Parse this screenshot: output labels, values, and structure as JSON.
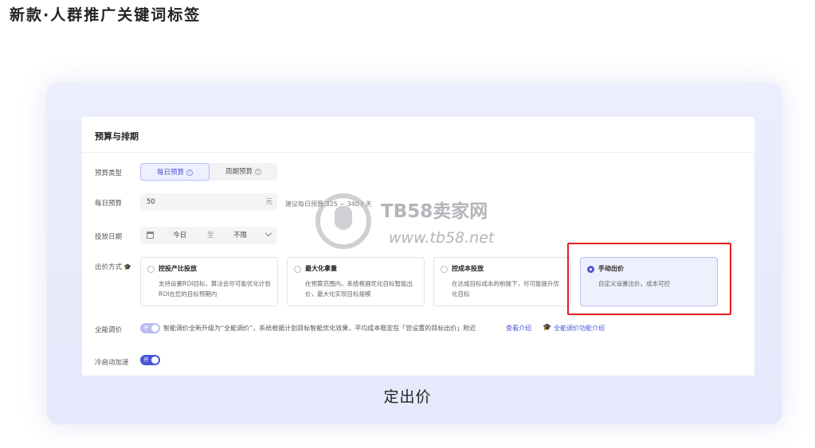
{
  "page": {
    "title": "新款·人群推广关键词标签",
    "caption": "定出价"
  },
  "panel": {
    "title": "预算与排期",
    "budget_type": {
      "label": "预算类型",
      "options": [
        "每日预算",
        "周期预算"
      ],
      "selected": "每日预算"
    },
    "daily_budget": {
      "label": "每日预算",
      "value": "50",
      "unit": "元",
      "hint": "建议每日预算 325 ~ 340 / 天"
    },
    "schedule": {
      "label": "投放日期",
      "start": "今日",
      "sep": "至",
      "end": "不限"
    },
    "bid_method": {
      "label": "出价方式",
      "cards": [
        {
          "title": "控投产比投放",
          "desc": "支持设置ROI目标，算法会尽可能优化计划ROI在您的目标预期内"
        },
        {
          "title": "最大化拿量",
          "desc": "在预算范围内，系统根据优化目标智能出价，最大化实现目标规模"
        },
        {
          "title": "控成本投放",
          "desc": "在达成目标成本的前提下，尽可能提升优化目标"
        },
        {
          "title": "手动出价",
          "desc": "自定义设置出价，成本可控"
        }
      ],
      "selected": "手动出价"
    },
    "smart_bid": {
      "label": "全能调价",
      "toggle": "开",
      "text": "智能调价全新升级为“全能调价”，系统根据计划目标智能优化效果，平均成本稳定在「您设置的目标出价」附近",
      "link1": "查看介绍",
      "link2": "全能调价功能介绍"
    },
    "cold_start": {
      "label": "冷启动加速",
      "toggle": "开"
    }
  },
  "watermark": {
    "name": "TB58卖家网",
    "url": "www.tb58.net"
  },
  "colors": {
    "accent": "#4b55d6",
    "highlight": "#e02020",
    "frame": "#e6e8fb"
  }
}
